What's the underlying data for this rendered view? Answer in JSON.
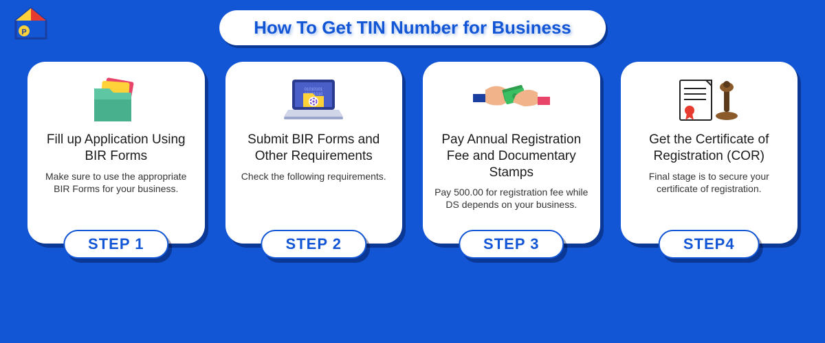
{
  "title": "How To Get TIN Number for Business",
  "steps": [
    {
      "label": "STEP 1",
      "icon": "folder-icon",
      "heading": "Fill up Application Using BIR Forms",
      "desc": "Make sure to use the appropriate BIR Forms for your business."
    },
    {
      "label": "STEP 2",
      "icon": "laptop-icon",
      "heading": "Submit BIR Forms and Other Requirements",
      "desc": "Check the following requirements."
    },
    {
      "label": "STEP 3",
      "icon": "payment-icon",
      "heading": "Pay Annual Registration Fee and Documentary Stamps",
      "desc": "Pay 500.00 for registration fee while DS depends on your business."
    },
    {
      "label": "STEP4",
      "icon": "certificate-icon",
      "heading": "Get the Certificate of Registration (COR)",
      "desc": "Final stage is to secure your certificate of registration."
    }
  ]
}
